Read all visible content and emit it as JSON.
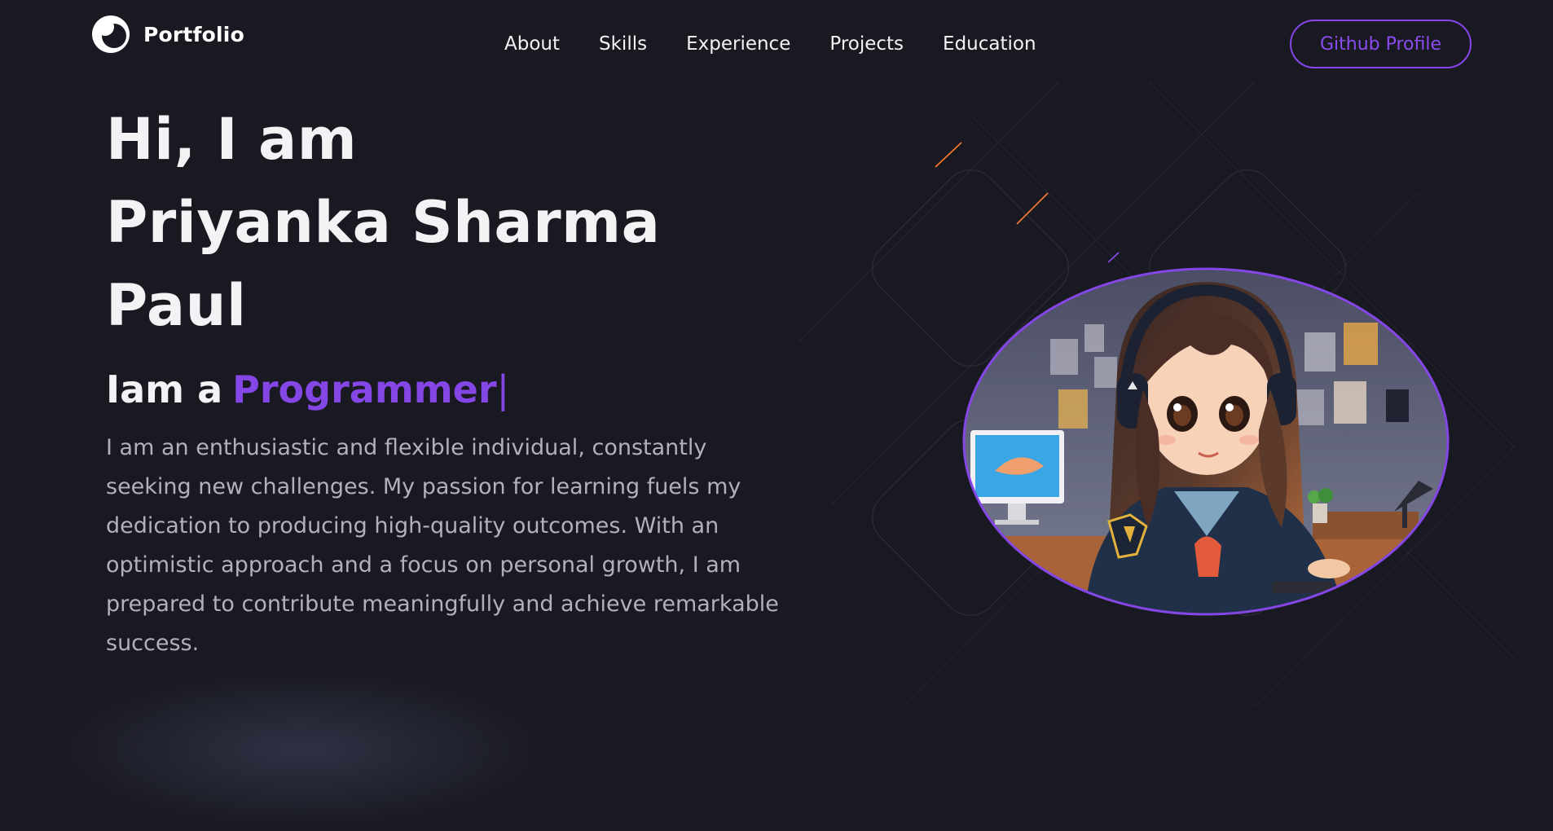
{
  "brand": {
    "name": "Portfolio",
    "logo_icon": "logo-ring-icon"
  },
  "nav": {
    "links": [
      {
        "label": "About"
      },
      {
        "label": "Skills"
      },
      {
        "label": "Experience"
      },
      {
        "label": "Projects"
      },
      {
        "label": "Education"
      }
    ],
    "cta_label": "Github Profile"
  },
  "hero": {
    "greeting": "Hi, I am",
    "name_line1": "Priyanka Sharma",
    "name_line2": "Paul",
    "role_prefix": "Iam a",
    "role": "Programmer",
    "cursor": "|",
    "bio": "I am an enthusiastic and flexible individual, constantly seeking new challenges. My passion for learning fuels my dedication to producing high-quality outcomes. With an optimistic approach and a focus on personal growth, I am prepared to contribute meaningfully and achieve remarkable success."
  },
  "colors": {
    "background": "#191921",
    "accent": "#8546e6",
    "text_primary": "#f2f3f4",
    "text_secondary": "#b2b1bb"
  }
}
